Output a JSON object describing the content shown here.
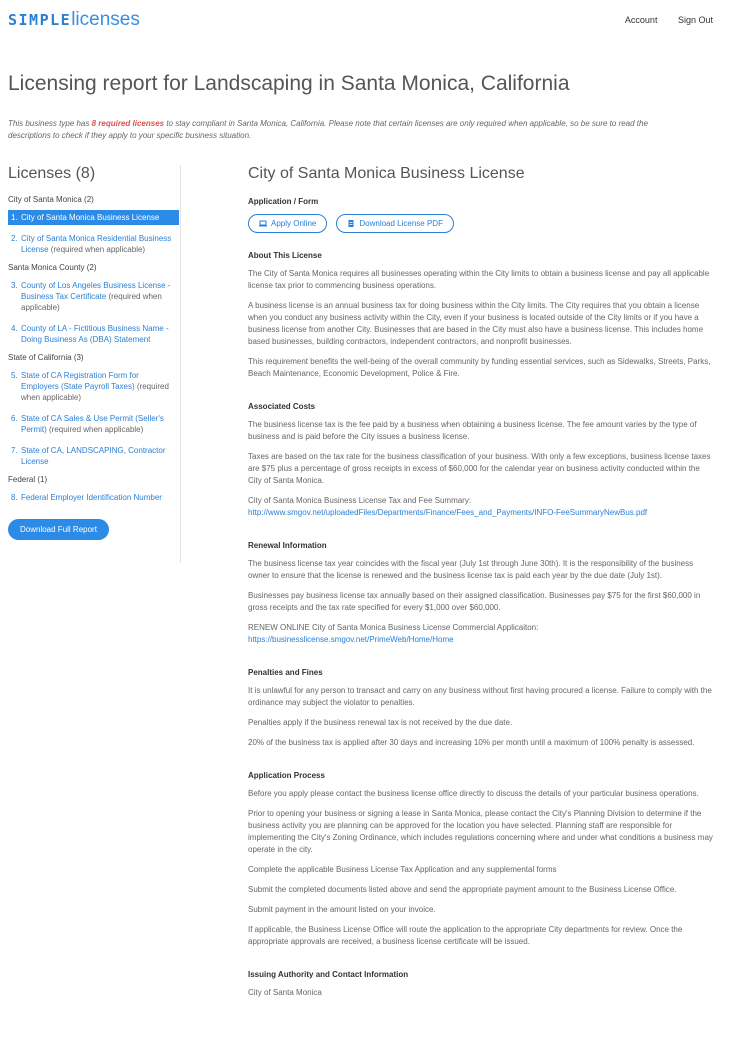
{
  "header": {
    "logo_part1": "SIMPLE",
    "logo_part2": "licenses",
    "nav": [
      "Account",
      "Sign Out"
    ]
  },
  "page_title": "Licensing report for Landscaping in Santa Monica, California",
  "intro": {
    "before": "This business type has ",
    "highlight": "8 required licenses",
    "after": " to stay compliant in Santa Monica, California. Please note that certain licenses are only required when applicable, so be sure to read the descriptions to check if they apply to your specific business situation."
  },
  "sidebar": {
    "title": "Licenses (8)",
    "groups": [
      {
        "label": "City of Santa Monica (2)",
        "items": [
          {
            "num": "1.",
            "label": "City of Santa Monica Business License",
            "note": ""
          },
          {
            "num": "2.",
            "label": "City of Santa Monica Residential Business License",
            "note": " (required when applicable)"
          }
        ]
      },
      {
        "label": "Santa Monica County (2)",
        "items": [
          {
            "num": "3.",
            "label": "County of Los Angeles Business License - Business Tax Certificate",
            "note": " (required when applicable)"
          },
          {
            "num": "4.",
            "label": "County of LA - Fictitious Business Name - Doing Business As (DBA) Statement",
            "note": ""
          }
        ]
      },
      {
        "label": "State of California (3)",
        "items": [
          {
            "num": "5.",
            "label": "State of CA Registration Form for Employers (State Payroll Taxes)",
            "note": " (required when applicable)"
          },
          {
            "num": "6.",
            "label": "State of CA Sales & Use Permit (Seller's Permit)",
            "note": " (required when applicable)"
          },
          {
            "num": "7.",
            "label": "State of CA, LANDSCAPING, Contractor License",
            "note": ""
          }
        ]
      },
      {
        "label": "Federal (1)",
        "items": [
          {
            "num": "8.",
            "label": "Federal Employer Identification Number",
            "note": ""
          }
        ]
      }
    ],
    "download_label": "Download Full Report"
  },
  "main": {
    "title": "City of Santa Monica Business License",
    "app_form_heading": "Application / Form",
    "apply_online": "Apply Online",
    "download_pdf": "Download License PDF",
    "about_heading": "About This License",
    "about": [
      "The City of Santa Monica requires all businesses operating within the City limits to obtain a business license and pay all applicable license tax prior to commencing business operations.",
      "A business license is an annual business tax for doing business within the City limits. The City requires that you obtain a license when you conduct any business activity within the City, even if your business is located outside of the City limits or if you have a business license from another City. Businesses that are based in the City must also have a business license. This includes home based businesses, building contractors, independent contractors, and nonprofit businesses.",
      "This requirement benefits the well-being of the overall community by funding essential services, such as Sidewalks, Streets, Parks, Beach Maintenance, Economic Development, Police & Fire."
    ],
    "costs_heading": "Associated Costs",
    "costs": [
      "The business license tax is the fee paid by a business when obtaining a business license. The fee amount varies by the type of business and is paid before the City issues a business license.",
      "Taxes are based on the tax rate for the business classification of your business. With only a few exceptions, business license taxes are $75 plus a percentage of gross receipts in excess of $60,000 for the calendar year on business activity conducted within the City of Santa Monica."
    ],
    "costs_summary_label": "City of Santa Monica Business License Tax and Fee Summary:",
    "costs_summary_url": "http://www.smgov.net/uploadedFiles/Departments/Finance/Fees_and_Payments/INFO-FeeSummaryNewBus.pdf",
    "renewal_heading": "Renewal Information",
    "renewal": [
      "The business license tax year coincides with the fiscal year (July 1st through June 30th). It is the responsibility of the business owner to ensure that the license is renewed and the business license tax is paid each year by the due date (July 1st).",
      "Businesses pay business license tax annually based on their assigned classification. Businesses pay $75 for the first $60,000 in gross receipts and the tax rate specified for every $1,000 over $60,000."
    ],
    "renewal_online_label": "RENEW ONLINE City of Santa Monica Business License Commercial Applicaiton:",
    "renewal_online_url": "https://businesslicense.smgov.net/PrimeWeb/Home/Home",
    "penalties_heading": "Penalties and Fines",
    "penalties": [
      "It is unlawful for any person to transact and carry on any business without first having procured a license. Failure to comply with the ordinance may subject the violator to penalties.",
      "Penalties apply if the business renewal tax is not received by the due date.",
      "20% of the business tax is applied after 30 days and increasing 10% per month until a maximum of 100% penalty is assessed."
    ],
    "process_heading": "Application Process",
    "process": [
      "Before you apply please contact the business license office directly to discuss the details of your particular business operations.",
      "Prior to opening your business or signing a lease in Santa Monica, please contact the City's Planning Division to determine if the business activity you are planning can be approved for the location you have selected. Planning staff are responsible for implementing the City's Zoning Ordinance, which includes regulations concerning where and under what conditions a business may operate in the city.",
      "Complete the applicable Business License Tax Application and any supplemental forms",
      "Submit the completed documents listed above and send the appropriate payment amount to the Business License Office.",
      "Submit payment in the amount listed on your invoice.",
      "If applicable, the Business License Office will route the application to the appropriate City departments for review. Once the appropriate approvals are received, a business license certificate will be issued."
    ],
    "issuing_heading": "Issuing Authority and Contact Information",
    "issuing_line1": "City of Santa Monica"
  }
}
